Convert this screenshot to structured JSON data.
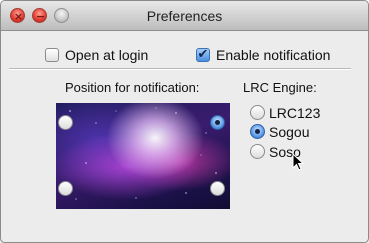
{
  "window": {
    "title": "Preferences",
    "close_symbol": "×",
    "minimize_symbol": "−"
  },
  "options": {
    "open_at_login": {
      "label": "Open at login",
      "checked": false
    },
    "enable_notification": {
      "label": "Enable notification",
      "checked": true
    }
  },
  "position": {
    "label": "Position for notification:",
    "choices": [
      "top-left",
      "top-right",
      "bottom-left",
      "bottom-right"
    ],
    "selected": "top-right"
  },
  "lrc_engine": {
    "label": "LRC Engine:",
    "options": [
      {
        "label": "LRC123",
        "selected": false
      },
      {
        "label": "Sogou",
        "selected": true
      },
      {
        "label": "Soso",
        "selected": false
      }
    ]
  },
  "colors": {
    "accent": "#4a8ee0",
    "close_button": "#e0392f",
    "zoom_button_disabled": "#c8c8c8",
    "window_background": "#ececec"
  },
  "icons": {
    "checkmark": "checkmark-icon",
    "cursor": "mouse-pointer-icon"
  }
}
